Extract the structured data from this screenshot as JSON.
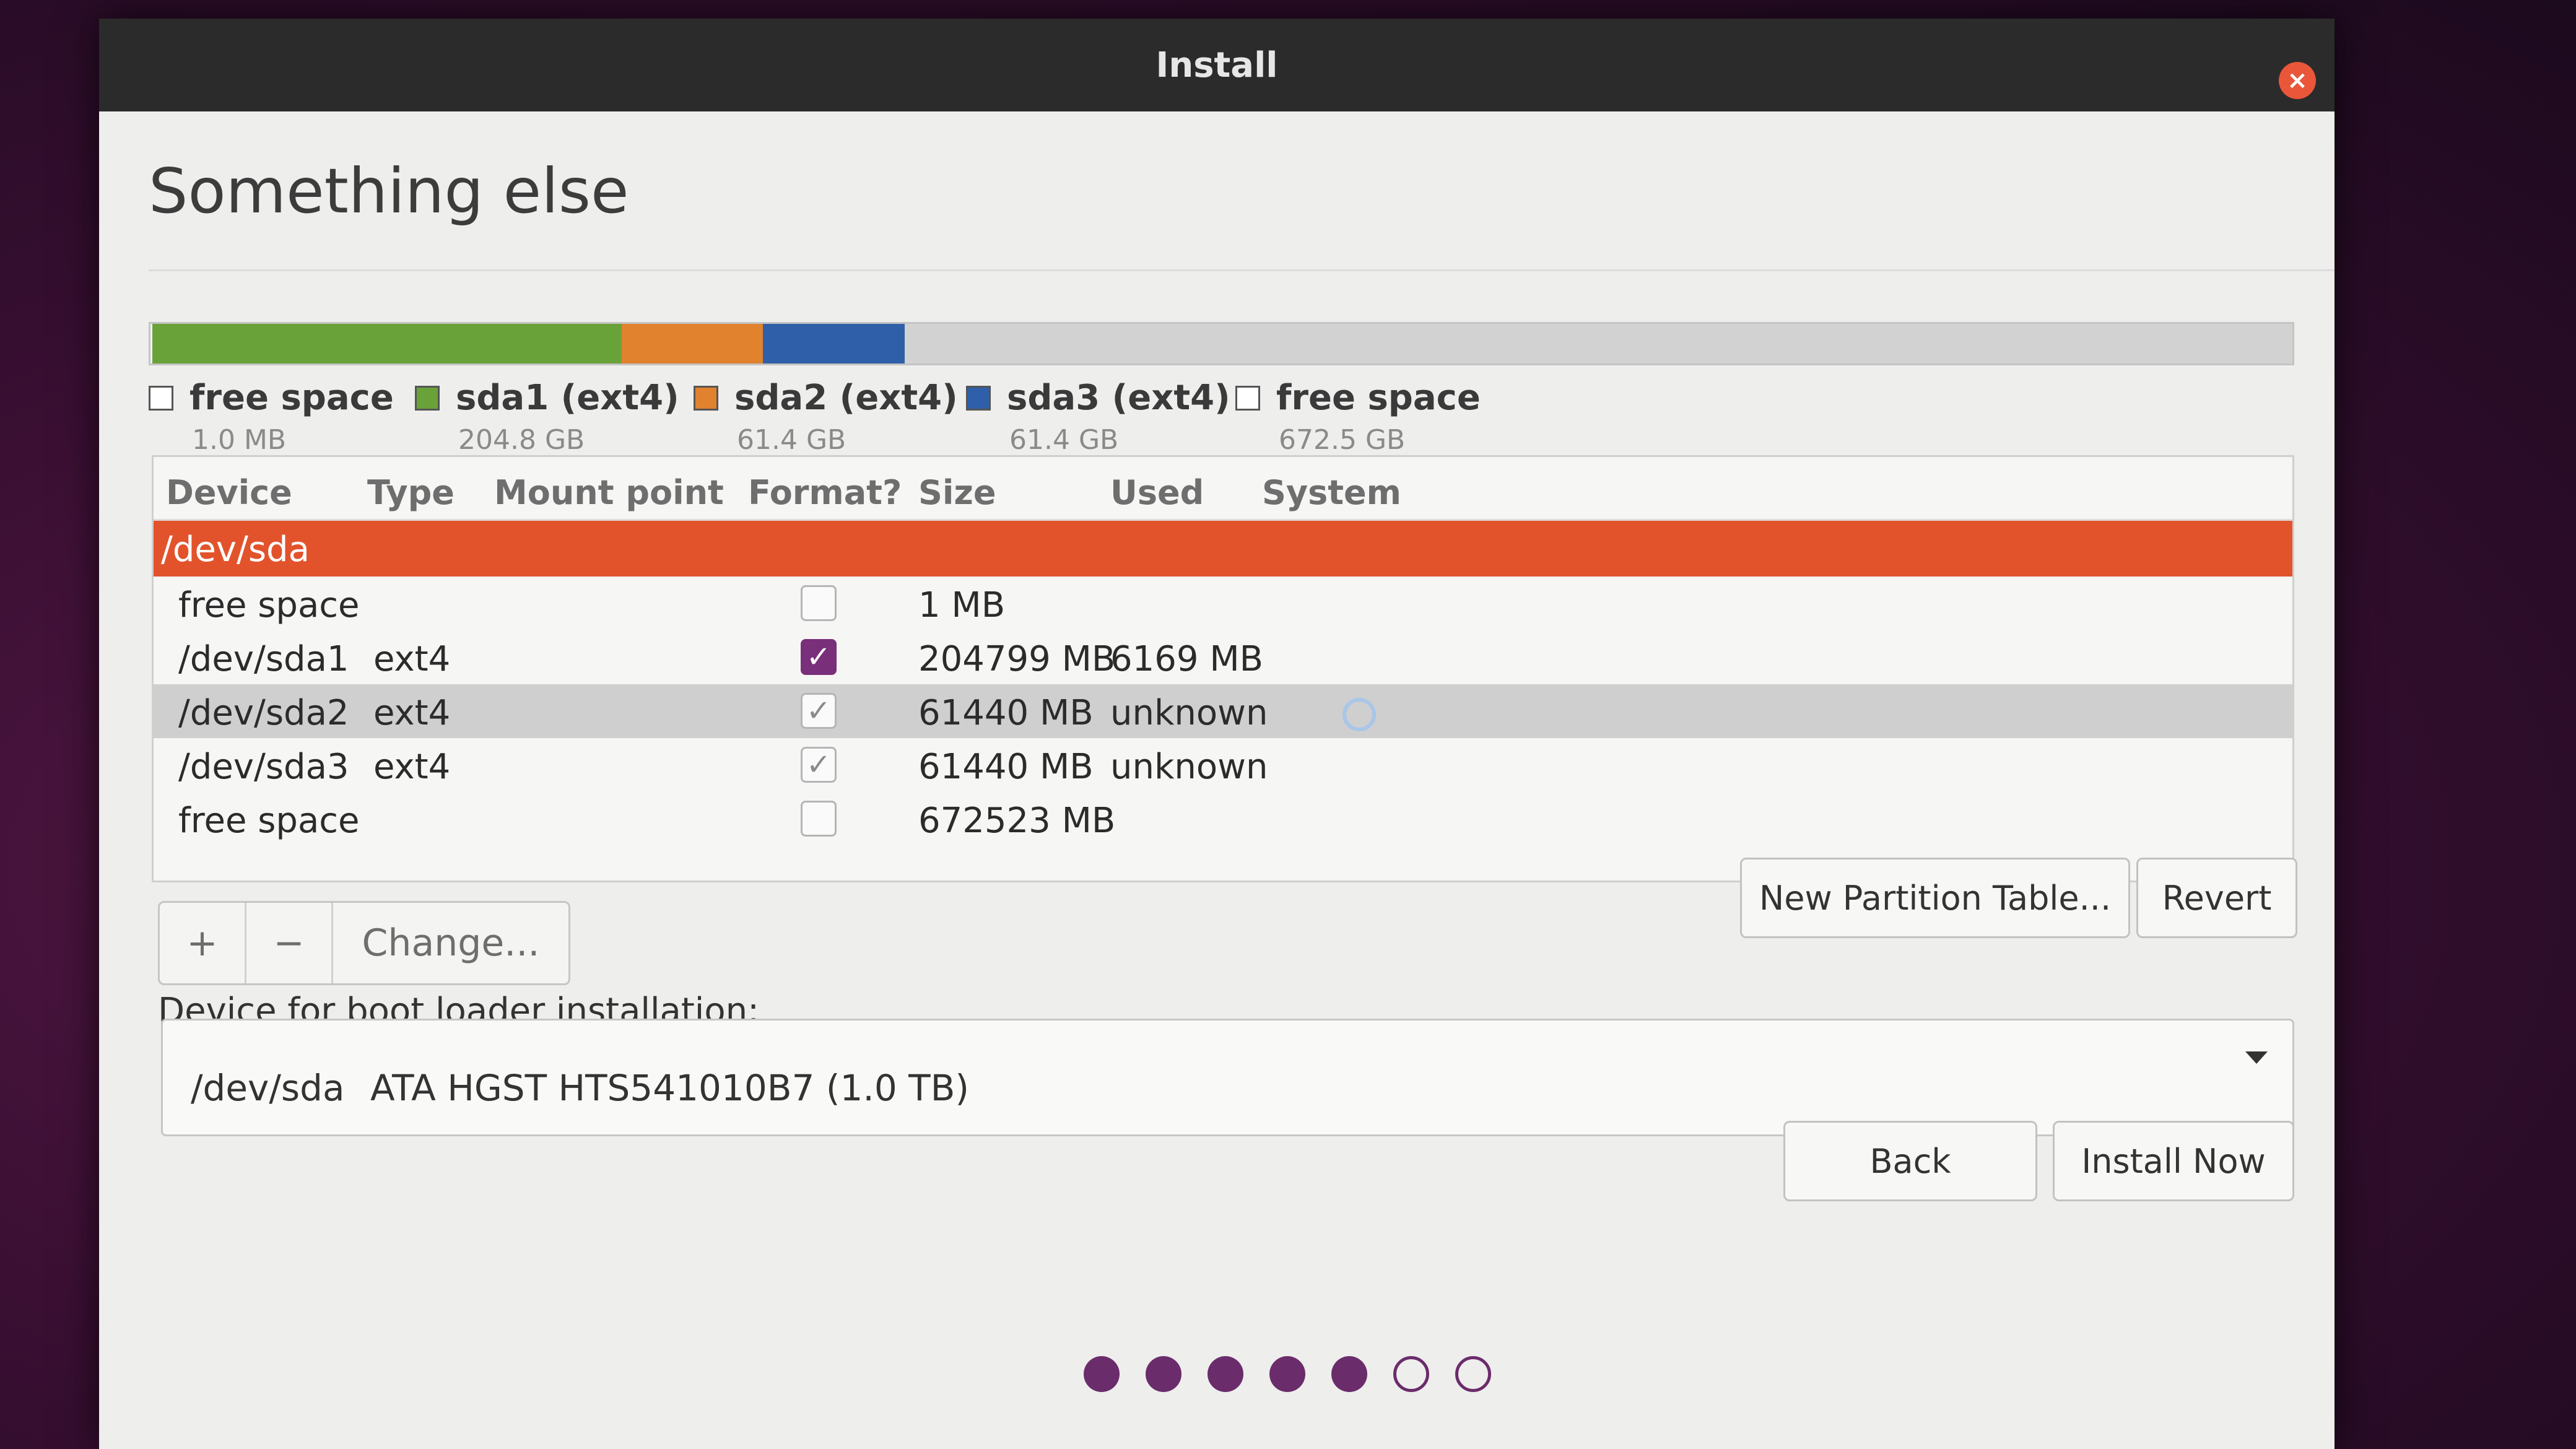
{
  "window": {
    "title": "Install"
  },
  "page": {
    "title": "Something else"
  },
  "partition_bar": {
    "segments": [
      {
        "color": "#f2f2f2",
        "fraction": 0.001
      },
      {
        "color": "#6aa23a",
        "fraction": 0.219
      },
      {
        "color": "#e0822e",
        "fraction": 0.066
      },
      {
        "color": "#2f5fa8",
        "fraction": 0.066
      },
      {
        "color": "#d2d2d2",
        "fraction": 0.648
      }
    ]
  },
  "legend": [
    {
      "label": "free space",
      "size": "1.0 MB",
      "color": "#ffffff"
    },
    {
      "label": "sda1 (ext4)",
      "size": "204.8 GB",
      "color": "#6aa23a"
    },
    {
      "label": "sda2 (ext4)",
      "size": "61.4 GB",
      "color": "#e0822e"
    },
    {
      "label": "sda3 (ext4)",
      "size": "61.4 GB",
      "color": "#2f5fa8"
    },
    {
      "label": "free space",
      "size": "672.5 GB",
      "color": "#ffffff"
    }
  ],
  "table": {
    "headers": {
      "device": "Device",
      "type": "Type",
      "mount": "Mount point",
      "format": "Format?",
      "size": "Size",
      "used": "Used",
      "system": "System"
    },
    "disk": "/dev/sda",
    "rows": [
      {
        "device": "free space",
        "type": "",
        "format": "unchecked",
        "size": "1 MB",
        "used": ""
      },
      {
        "device": "/dev/sda1",
        "type": "ext4",
        "format": "checked-active",
        "size": "204799 MB",
        "used": "6169 MB"
      },
      {
        "device": "/dev/sda2",
        "type": "ext4",
        "format": "checked",
        "size": "61440 MB",
        "used": "unknown"
      },
      {
        "device": "/dev/sda3",
        "type": "ext4",
        "format": "checked",
        "size": "61440 MB",
        "used": "unknown"
      },
      {
        "device": "free space",
        "type": "",
        "format": "unchecked",
        "size": "672523 MB",
        "used": ""
      }
    ],
    "check_glyph": "✓"
  },
  "tools": {
    "add": "+",
    "remove": "−",
    "change": "Change..."
  },
  "buttons": {
    "new_partition_table": "New Partition Table...",
    "revert": "Revert",
    "back": "Back",
    "install_now": "Install Now"
  },
  "bootloader": {
    "label": "Device for boot loader installation:",
    "device": "/dev/sda",
    "description": "ATA HGST HTS541010B7 (1.0 TB)"
  },
  "progress": {
    "total_steps": 7,
    "completed_steps": 5
  }
}
